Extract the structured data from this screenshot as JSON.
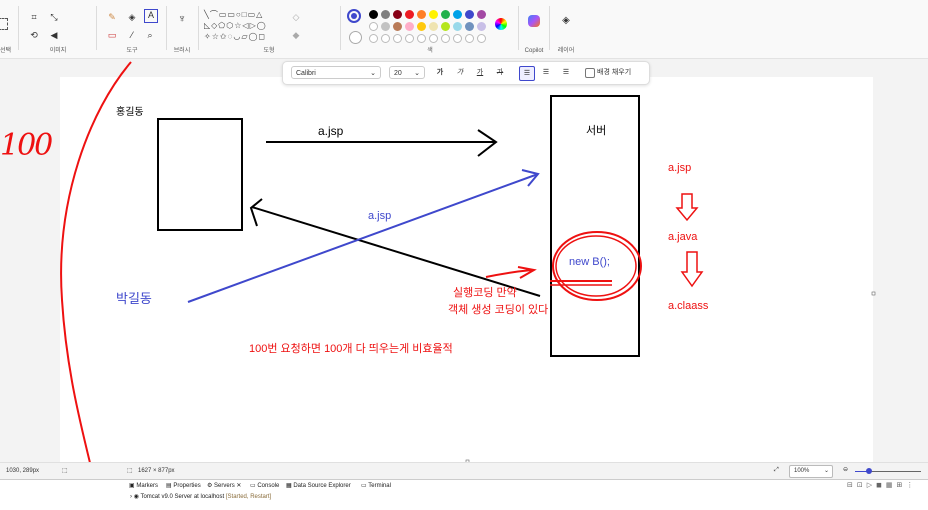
{
  "ribbon": {
    "groups": [
      {
        "label": "선택"
      },
      {
        "label": "이미지"
      },
      {
        "label": "도구"
      },
      {
        "label": "브러시"
      },
      {
        "label": "도형"
      },
      {
        "label": "색"
      },
      {
        "label": "Copilot"
      },
      {
        "label": "레이어"
      }
    ],
    "colors_row1": [
      "#000000",
      "#7f7f7f",
      "#880015",
      "#ed1c24",
      "#ff7f27",
      "#fff200",
      "#22b14c",
      "#00a2e8",
      "#3f48cc",
      "#a349a4"
    ],
    "colors_row2": [
      "#ffffff",
      "#c3c3c3",
      "#b97a57",
      "#ffaec9",
      "#ffc90e",
      "#efe4b0",
      "#b5e61d",
      "#99d9ea",
      "#7092be",
      "#c8bfe7"
    ],
    "primary_color": "#3f48cc",
    "icons": {
      "text_tool": "A"
    }
  },
  "textbar": {
    "font": "Calibri",
    "size": "20",
    "bold_label": "가",
    "italic_label": "가",
    "underline_label": "가",
    "strike_label": "가",
    "fill_label": "배경 채우기"
  },
  "canvas": {
    "client_label": "홍길동",
    "server_label": "서버",
    "request_label": "a.jsp",
    "response_label": "a.jsp",
    "user2_label": "박길동",
    "new_b_label": "new B();",
    "annot_line1": "실행코딩 만약",
    "annot_line2": "객체 생성 코딩이 있다",
    "red_jsp": "a.jsp",
    "red_java": "a.java",
    "red_class": "a.claass",
    "bottom_note": "100번 요청하면 100개 다 띄우는게 비효율적",
    "margin_note": "100"
  },
  "statusbar": {
    "cursor_pos": "1030, 289px",
    "canvas_size": "1627 × 877px",
    "zoom": "100%"
  },
  "eclipse": {
    "tabs": [
      "Markers",
      "Properties",
      "Servers",
      "Console",
      "Data Source Explorer",
      "Terminal"
    ],
    "server_entry": "Tomcat v9.0 Server at localhost",
    "server_state": "[Started, Restart]"
  }
}
